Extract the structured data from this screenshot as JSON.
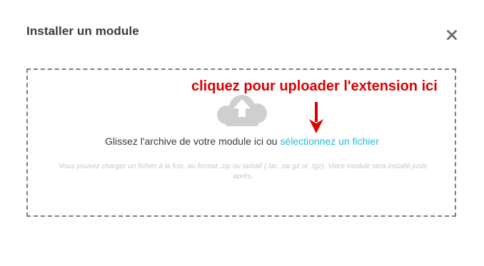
{
  "modal": {
    "title": "Installer un module",
    "close_icon": "close-icon"
  },
  "dropzone": {
    "upload_icon": "cloud-upload-icon",
    "text_prefix": "Glissez l'archive de votre module ici ou",
    "link_label": "sélectionnez un fichier",
    "help_text": "Vous pouvez charger un fichier à la fois, au format .zip ou tarball (.tar, .tar.gz or .tgz). Votre module sera installé juste après."
  },
  "annotation": {
    "text": "cliquez pour uploader l'extension ici",
    "color": "#dd0000",
    "arrow_icon": "arrow-down-icon"
  },
  "colors": {
    "title": "#363a41",
    "link": "#25b9d7",
    "border": "#6c868e",
    "help": "#c8c8c8",
    "cloud": "#cfcfcf"
  }
}
